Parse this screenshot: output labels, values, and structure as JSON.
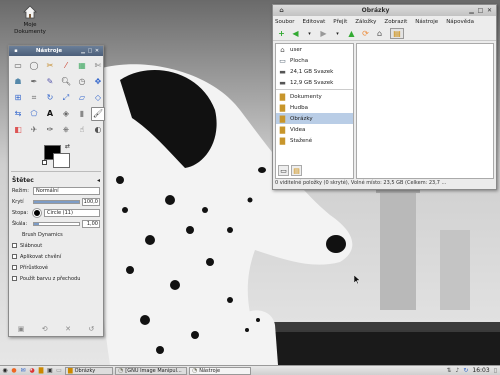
{
  "desktop": {
    "icon_label": "Moje\nDokumenty",
    "icon_label_line1": "Moje",
    "icon_label_line2": "Dokumenty"
  },
  "toolbox": {
    "title": "Nástroje",
    "options_title": "Štětec",
    "mode_label": "Režim:",
    "mode_value": "Normální",
    "opacity_label": "Krytí",
    "opacity_value": "100,0",
    "opacity_level": 1.0,
    "brush_label": "Stopa:",
    "brush_value": "Circle (11)",
    "scale_label": "Škála:",
    "scale_value": "1,00",
    "scale_level": 0.1,
    "dynamics_label": "Brush Dynamics",
    "opt_fade": "Slábnout",
    "opt_jitter": "Aplikovat chvění",
    "opt_incremental": "Přírůstkové",
    "opt_gradient": "Použít barvu z přechodu"
  },
  "filemanager": {
    "title": "Obrázky",
    "menu": [
      "Soubor",
      "Editovat",
      "Přejít",
      "Záložky",
      "Zobrazit",
      "Nástroje",
      "Nápověda"
    ],
    "places_group1": [
      {
        "label": "user",
        "icon": "home-icon"
      },
      {
        "label": "Plocha",
        "icon": "desktop-icon"
      },
      {
        "label": "24,1 GB Svazek",
        "icon": "drive-icon"
      },
      {
        "label": "12,9 GB Svazek",
        "icon": "drive-icon"
      }
    ],
    "places_group2": [
      {
        "label": "Dokumenty",
        "icon": "folder-icon"
      },
      {
        "label": "Hudba",
        "icon": "folder-icon"
      },
      {
        "label": "Obrázky",
        "icon": "folder-icon",
        "selected": true
      },
      {
        "label": "Videa",
        "icon": "folder-icon"
      },
      {
        "label": "Stažené",
        "icon": "folder-icon"
      }
    ],
    "status": "0 viditelné položky (0 skryté), Volné místo: 23,5 GB (Celkem: 23,7 ..."
  },
  "taskbar": {
    "tasks": [
      {
        "label": "Obrázky",
        "icon": "folder-icon"
      },
      {
        "label": "[GNU Image Manipul...",
        "icon": "gimp-icon"
      },
      {
        "label": "Nástroje",
        "icon": "gimp-icon",
        "active": true
      }
    ],
    "clock": "16:03"
  },
  "colors": {
    "gimp_title": "#4c5f7a",
    "selection": "#b9cde6",
    "foreground": "#000000",
    "background": "#ffffff"
  }
}
